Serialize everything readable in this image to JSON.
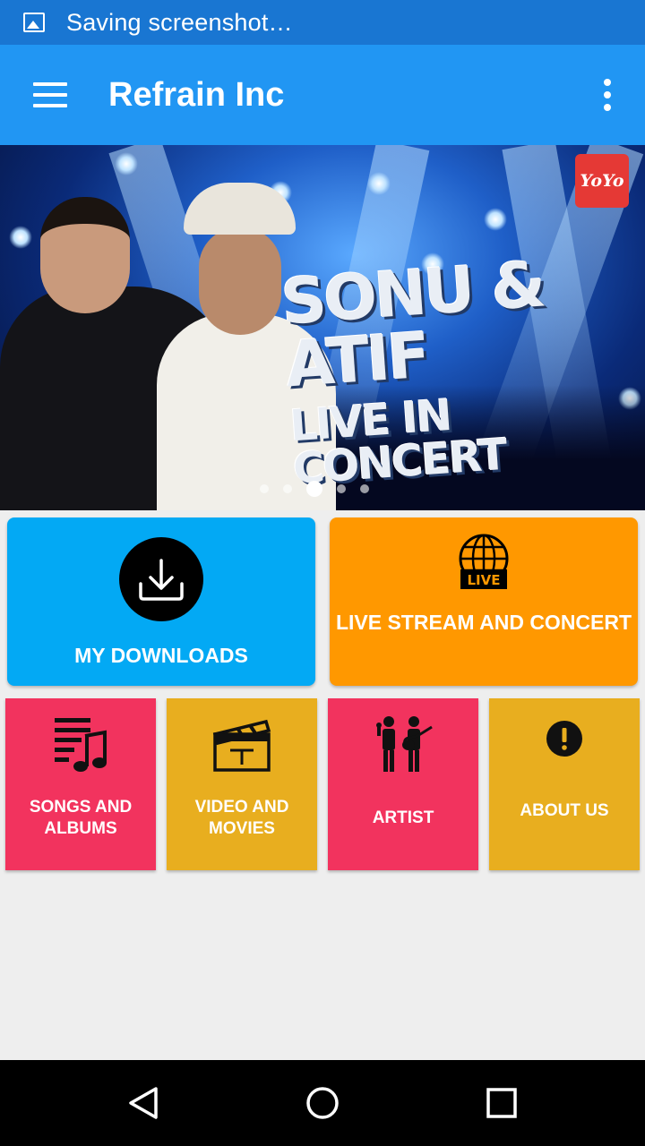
{
  "status_bar": {
    "text": "Saving screenshot…",
    "icon": "image-icon"
  },
  "app_bar": {
    "title": "Refrain Inc",
    "menu_icon": "hamburger-menu-icon",
    "overflow_icon": "more-vertical-icon"
  },
  "banner": {
    "headline_line1": "SONU & ATIF",
    "headline_line2": "LIVE IN CONCERT",
    "logo_text": "YoYo",
    "slide_count": 5,
    "active_slide": 3
  },
  "cards": {
    "downloads": {
      "label": "MY DOWNLOADS",
      "icon": "download-icon",
      "color": "#03a9f4"
    },
    "live": {
      "label": "LIVE STREAM AND CONCERT",
      "icon": "live-globe-icon",
      "badge": "LIVE",
      "color": "#ff9800"
    }
  },
  "tiles": [
    {
      "label": "SONGS AND ALBUMS",
      "icon": "music-list-icon",
      "color": "#f2335e"
    },
    {
      "label": "VIDEO AND MOVIES",
      "icon": "clapperboard-icon",
      "color": "#e8ae1f"
    },
    {
      "label": "ARTIST",
      "icon": "musicians-icon",
      "color": "#f2335e"
    },
    {
      "label": "ABOUT US",
      "icon": "info-alert-icon",
      "color": "#e8ae1f"
    }
  ],
  "nav_bar": {
    "back_icon": "back-triangle-icon",
    "home_icon": "home-circle-icon",
    "recents_icon": "recents-square-icon"
  }
}
